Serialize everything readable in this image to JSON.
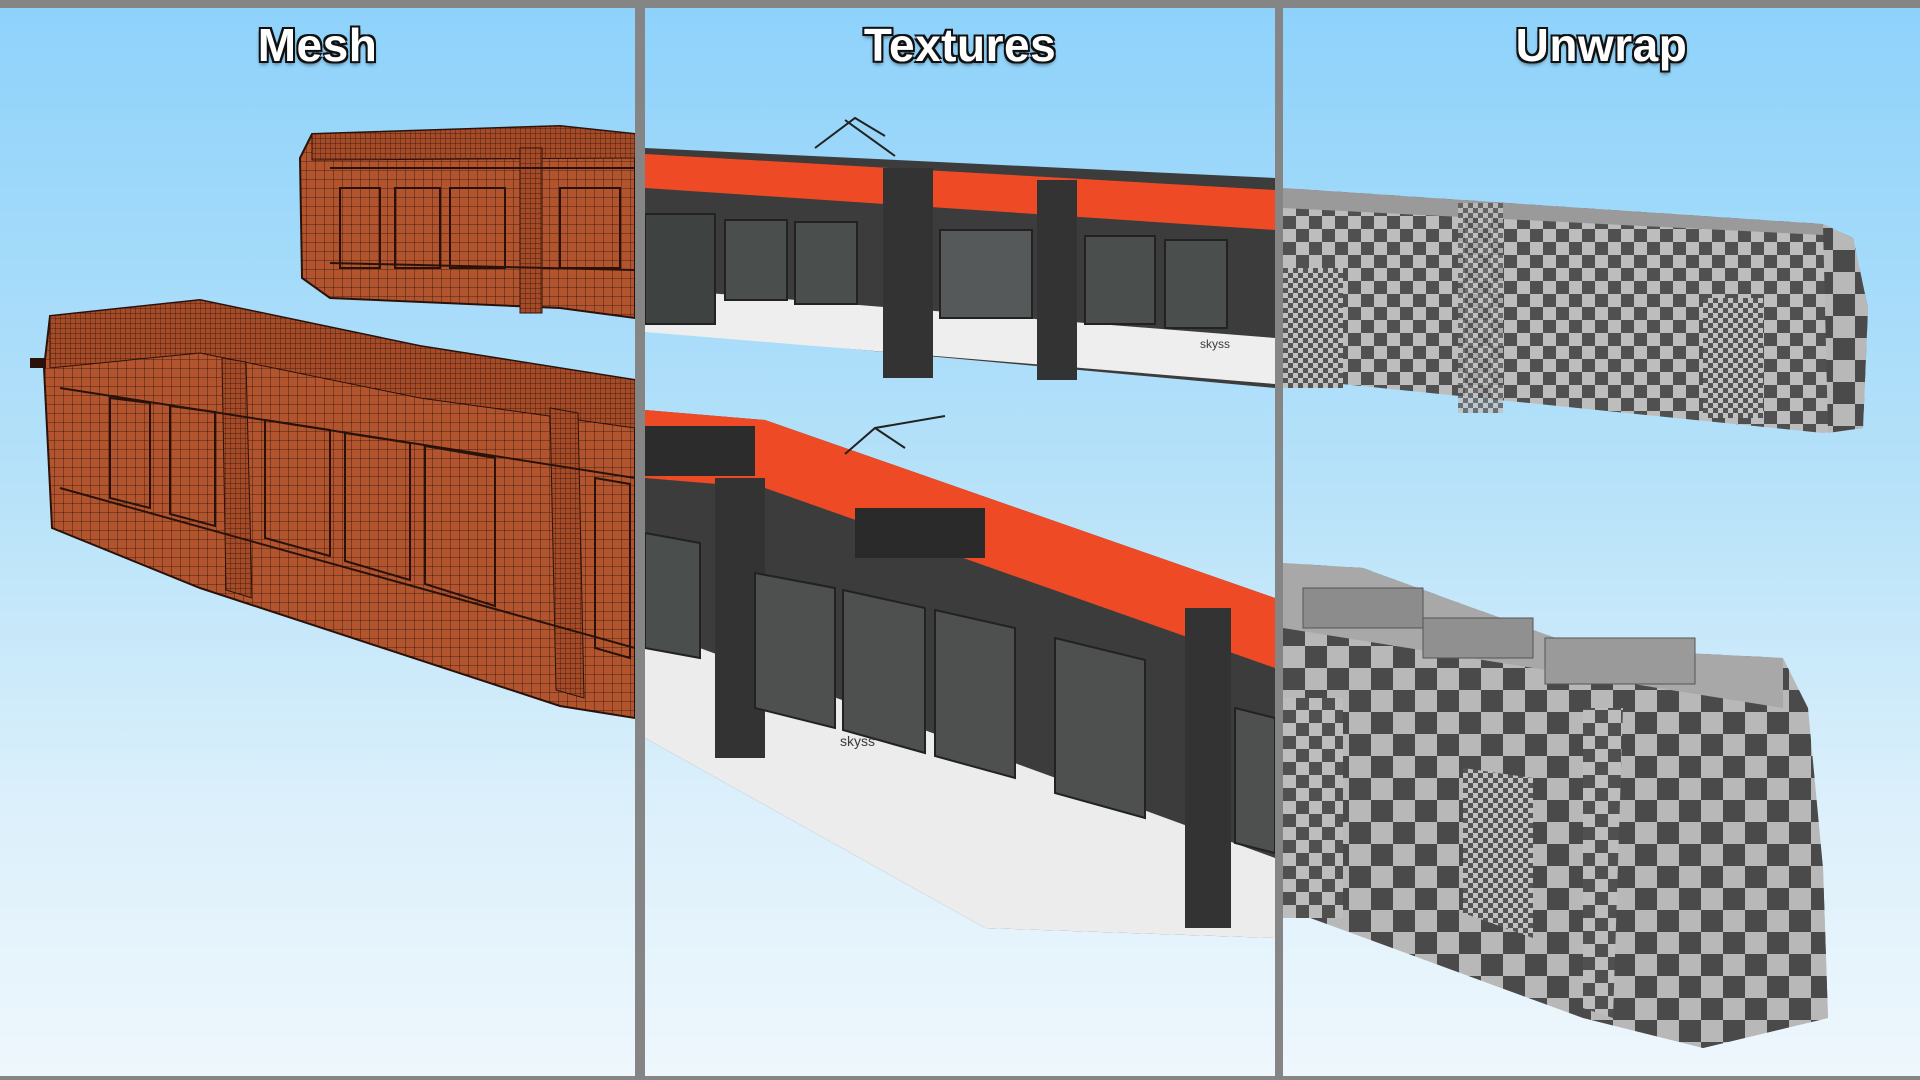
{
  "panels": [
    {
      "title": "Mesh"
    },
    {
      "title": "Textures"
    },
    {
      "title": "Unwrap"
    }
  ],
  "livery": {
    "brand": "skyss"
  },
  "colors": {
    "sky_top": "#8ed2fb",
    "sky_bottom": "#eef7fc",
    "mesh_fill": "#b2552e",
    "mesh_wire": "#2a120a",
    "tram_red": "#ee4a25",
    "tram_white": "#eeeeee",
    "tram_dark": "#3c3c3c",
    "checker_light": "#b8b8b8",
    "checker_dark": "#4a4a4a",
    "divider": "#858585"
  }
}
